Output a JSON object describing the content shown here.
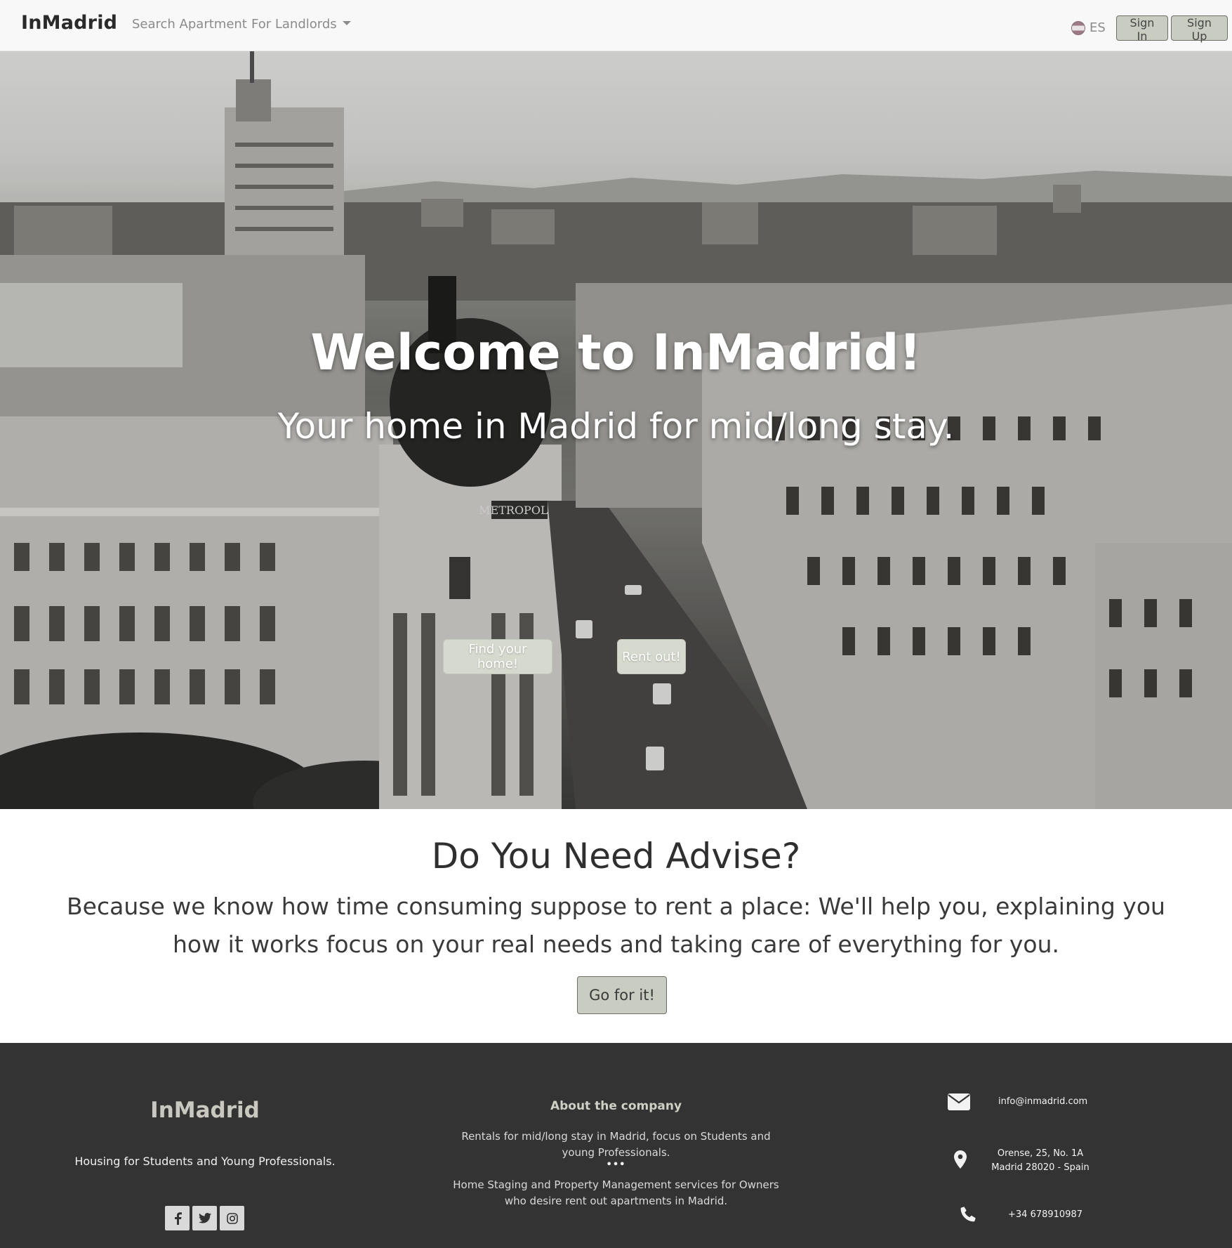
{
  "navbar": {
    "brand": "InMadrid",
    "links": [
      {
        "label": "Search Apartment"
      },
      {
        "label": "For Landlords"
      }
    ],
    "language": "ES",
    "sign_in": "Sign In",
    "sign_up": "Sign Up"
  },
  "hero": {
    "title": "Welcome to InMadrid!",
    "subtitle": "Your home in Madrid for mid/long stay.",
    "find_button": "Find your home!",
    "rent_button": "Rent out!",
    "sign_text": "METROPOLIS"
  },
  "advise": {
    "title": "Do You Need Advise?",
    "text": "Because we know how time consuming suppose to rent a place: We'll help you, explaining you how it works focus on your real needs and taking care of everything for you.",
    "button": "Go for it!"
  },
  "footer": {
    "brand": "InMadrid",
    "tagline": "Housing for Students and Young Professionals.",
    "socials": [
      "facebook-icon",
      "twitter-icon",
      "instagram-icon"
    ],
    "about_title": "About the company",
    "about_p1": "Rentals for mid/long stay in Madrid, focus on Students and young Professionals.",
    "about_separator": "•••",
    "about_p2": "Home Staging and Property Management services for Owners who desire rent out apartments in Madrid.",
    "email": "info@inmadrid.com",
    "address_line1": "Orense, 25, No. 1A",
    "address_line2": "Madrid 28020 - Spain",
    "phone": "+34 678910987"
  },
  "colors": {
    "navbar_bg": "#f8f8f8",
    "button_bg": "#c9ccc0",
    "footer_bg": "#333333"
  }
}
